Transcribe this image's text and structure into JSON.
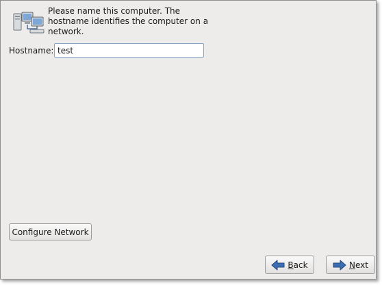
{
  "intro": {
    "icon": "network-computers-icon",
    "text": "Please name this computer.  The hostname identifies the computer on a network."
  },
  "hostname": {
    "label": "Hostname:",
    "value": "test"
  },
  "buttons": {
    "configure_network": "Configure Network",
    "back": {
      "mnemonic": "B",
      "rest": "ack"
    },
    "next": {
      "mnemonic": "N",
      "rest": "ext"
    }
  },
  "colors": {
    "window_bg": "#edeceb",
    "input_border": "#86a6c9",
    "arrow_blue": "#3c6eb4"
  }
}
